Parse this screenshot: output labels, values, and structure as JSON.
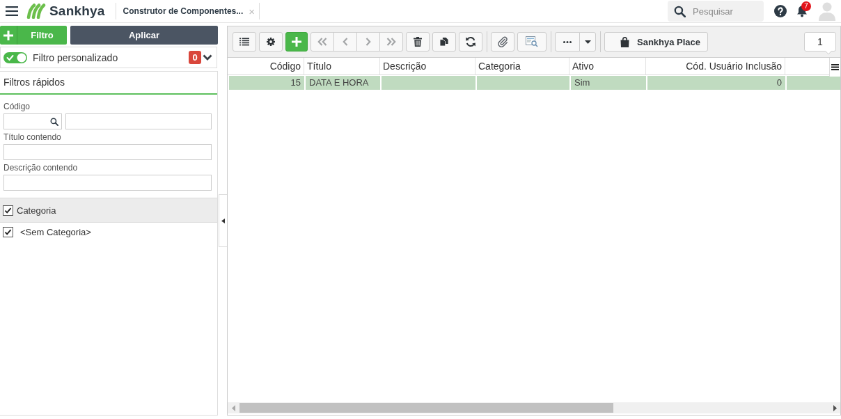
{
  "header": {
    "logo": "Sankhya",
    "tab": {
      "title": "Construtor de Componentes...",
      "close": "×"
    },
    "search": {
      "placeholder": "Pesquisar"
    },
    "notifications": {
      "count": "7"
    }
  },
  "filter_panel": {
    "add_filter_button": {
      "label": "Filtro"
    },
    "apply_button": {
      "label": "Aplicar"
    },
    "custom_filter": {
      "label": "Filtro personalizado",
      "on": true,
      "count": "0"
    },
    "quick_filters": {
      "title": "Filtros rápidos",
      "fields": [
        {
          "label": "Código",
          "kind": "lookup"
        },
        {
          "label": "Título contendo",
          "kind": "text"
        },
        {
          "label": "Descrição contendo",
          "kind": "text"
        }
      ],
      "category": {
        "label": "Categoria",
        "checked": true,
        "options": [
          {
            "label": "<Sem Categoria>",
            "checked": true
          }
        ]
      }
    }
  },
  "toolbar": {
    "sections": [
      {
        "groups": [
          {
            "buttons": [
              {
                "kind": "list",
                "disabled": false
              }
            ]
          },
          {
            "buttons": [
              {
                "kind": "settings",
                "disabled": false
              }
            ]
          },
          {
            "buttons": [
              {
                "kind": "add",
                "disabled": false
              }
            ]
          },
          {
            "buttons": [
              {
                "kind": "first",
                "disabled": true
              },
              {
                "kind": "previous",
                "disabled": true
              },
              {
                "kind": "next",
                "disabled": true
              },
              {
                "kind": "last",
                "disabled": true
              }
            ]
          },
          {
            "buttons": [
              {
                "kind": "delete",
                "disabled": false
              }
            ]
          },
          {
            "buttons": [
              {
                "kind": "copy",
                "disabled": false
              }
            ]
          },
          {
            "buttons": [
              {
                "kind": "refresh",
                "disabled": false
              }
            ]
          }
        ]
      },
      {
        "groups": [
          {
            "buttons": [
              {
                "kind": "attach",
                "disabled": false
              }
            ]
          },
          {
            "buttons": [
              {
                "kind": "preview",
                "disabled": false
              }
            ]
          }
        ]
      },
      {
        "groups": [
          {
            "buttons": [
              {
                "kind": "more",
                "disabled": false
              },
              {
                "kind": "dropdown",
                "disabled": false
              }
            ]
          }
        ]
      },
      {
        "groups": [
          {
            "buttons": [
              {
                "kind": "place",
                "label": "Sankhya Place",
                "disabled": false
              }
            ]
          }
        ]
      }
    ],
    "page": "1"
  },
  "table": {
    "columns": [
      {
        "label": "Código",
        "kind": "number"
      },
      {
        "label": "Título",
        "kind": "text"
      },
      {
        "label": "Descrição",
        "kind": "text"
      },
      {
        "label": "Categoria",
        "kind": "text"
      },
      {
        "label": "Ativo",
        "kind": "text"
      },
      {
        "label": "Cód. Usuário Inclusão",
        "kind": "number"
      }
    ],
    "rows": [
      {
        "selected": true,
        "cells": [
          "15",
          "DATA E HORA",
          null,
          null,
          "Sim",
          "0"
        ]
      }
    ]
  }
}
